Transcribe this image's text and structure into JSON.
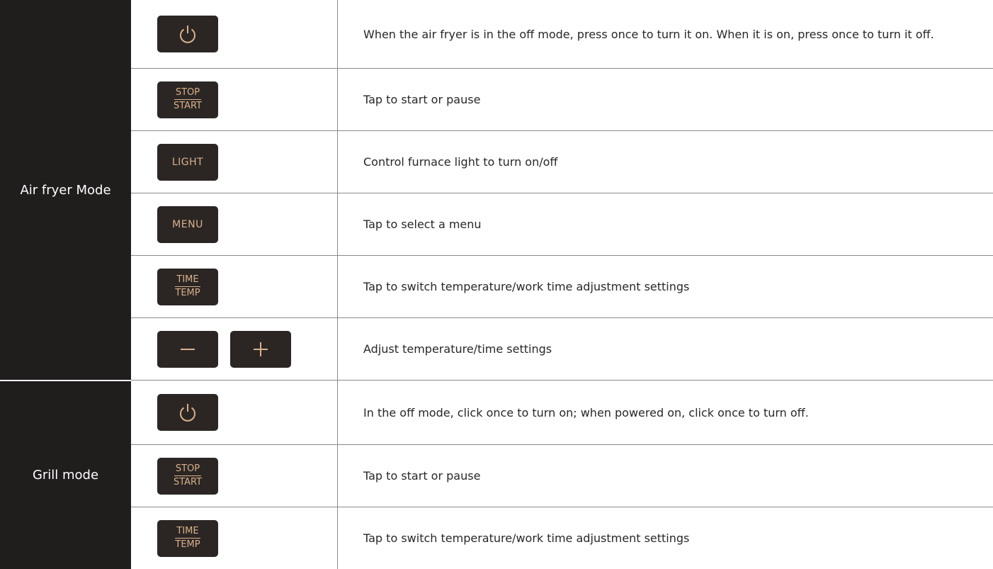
{
  "colors": {
    "mode_bg": "#201d1d",
    "key_bg": "#2b2624",
    "key_text": "#d9b08c",
    "rule": "#8a8a8a"
  },
  "modes": [
    {
      "label": "Air fryer Mode",
      "rows": [
        {
          "keys": [
            {
              "type": "icon",
              "icon": "power-icon"
            }
          ],
          "desc": "When the air fryer is in the off mode, press once to turn it on. When it is on, press once to turn it off."
        },
        {
          "keys": [
            {
              "type": "stack",
              "top": "STOP",
              "bottom": "START"
            }
          ],
          "desc": "Tap to start or pause"
        },
        {
          "keys": [
            {
              "type": "text",
              "text": "LIGHT"
            }
          ],
          "desc": "Control furnace light to turn on/off"
        },
        {
          "keys": [
            {
              "type": "text",
              "text": "MENU"
            }
          ],
          "desc": "Tap to select a menu"
        },
        {
          "keys": [
            {
              "type": "stack",
              "top": "TIME",
              "bottom": "TEMP"
            }
          ],
          "desc": "Tap to switch temperature/work time adjustment settings"
        },
        {
          "keys": [
            {
              "type": "icon",
              "icon": "minus-icon"
            },
            {
              "type": "icon",
              "icon": "plus-icon"
            }
          ],
          "desc": "Adjust temperature/time settings"
        }
      ]
    },
    {
      "label": "Grill mode",
      "rows": [
        {
          "keys": [
            {
              "type": "icon",
              "icon": "power-icon"
            }
          ],
          "desc": "In the off mode, click once to turn on; when powered on, click once to turn off."
        },
        {
          "keys": [
            {
              "type": "stack",
              "top": "STOP",
              "bottom": "START"
            }
          ],
          "desc": "Tap to start or pause"
        },
        {
          "keys": [
            {
              "type": "stack",
              "top": "TIME",
              "bottom": "TEMP"
            }
          ],
          "desc": "Tap to switch temperature/work time adjustment settings"
        }
      ]
    }
  ]
}
